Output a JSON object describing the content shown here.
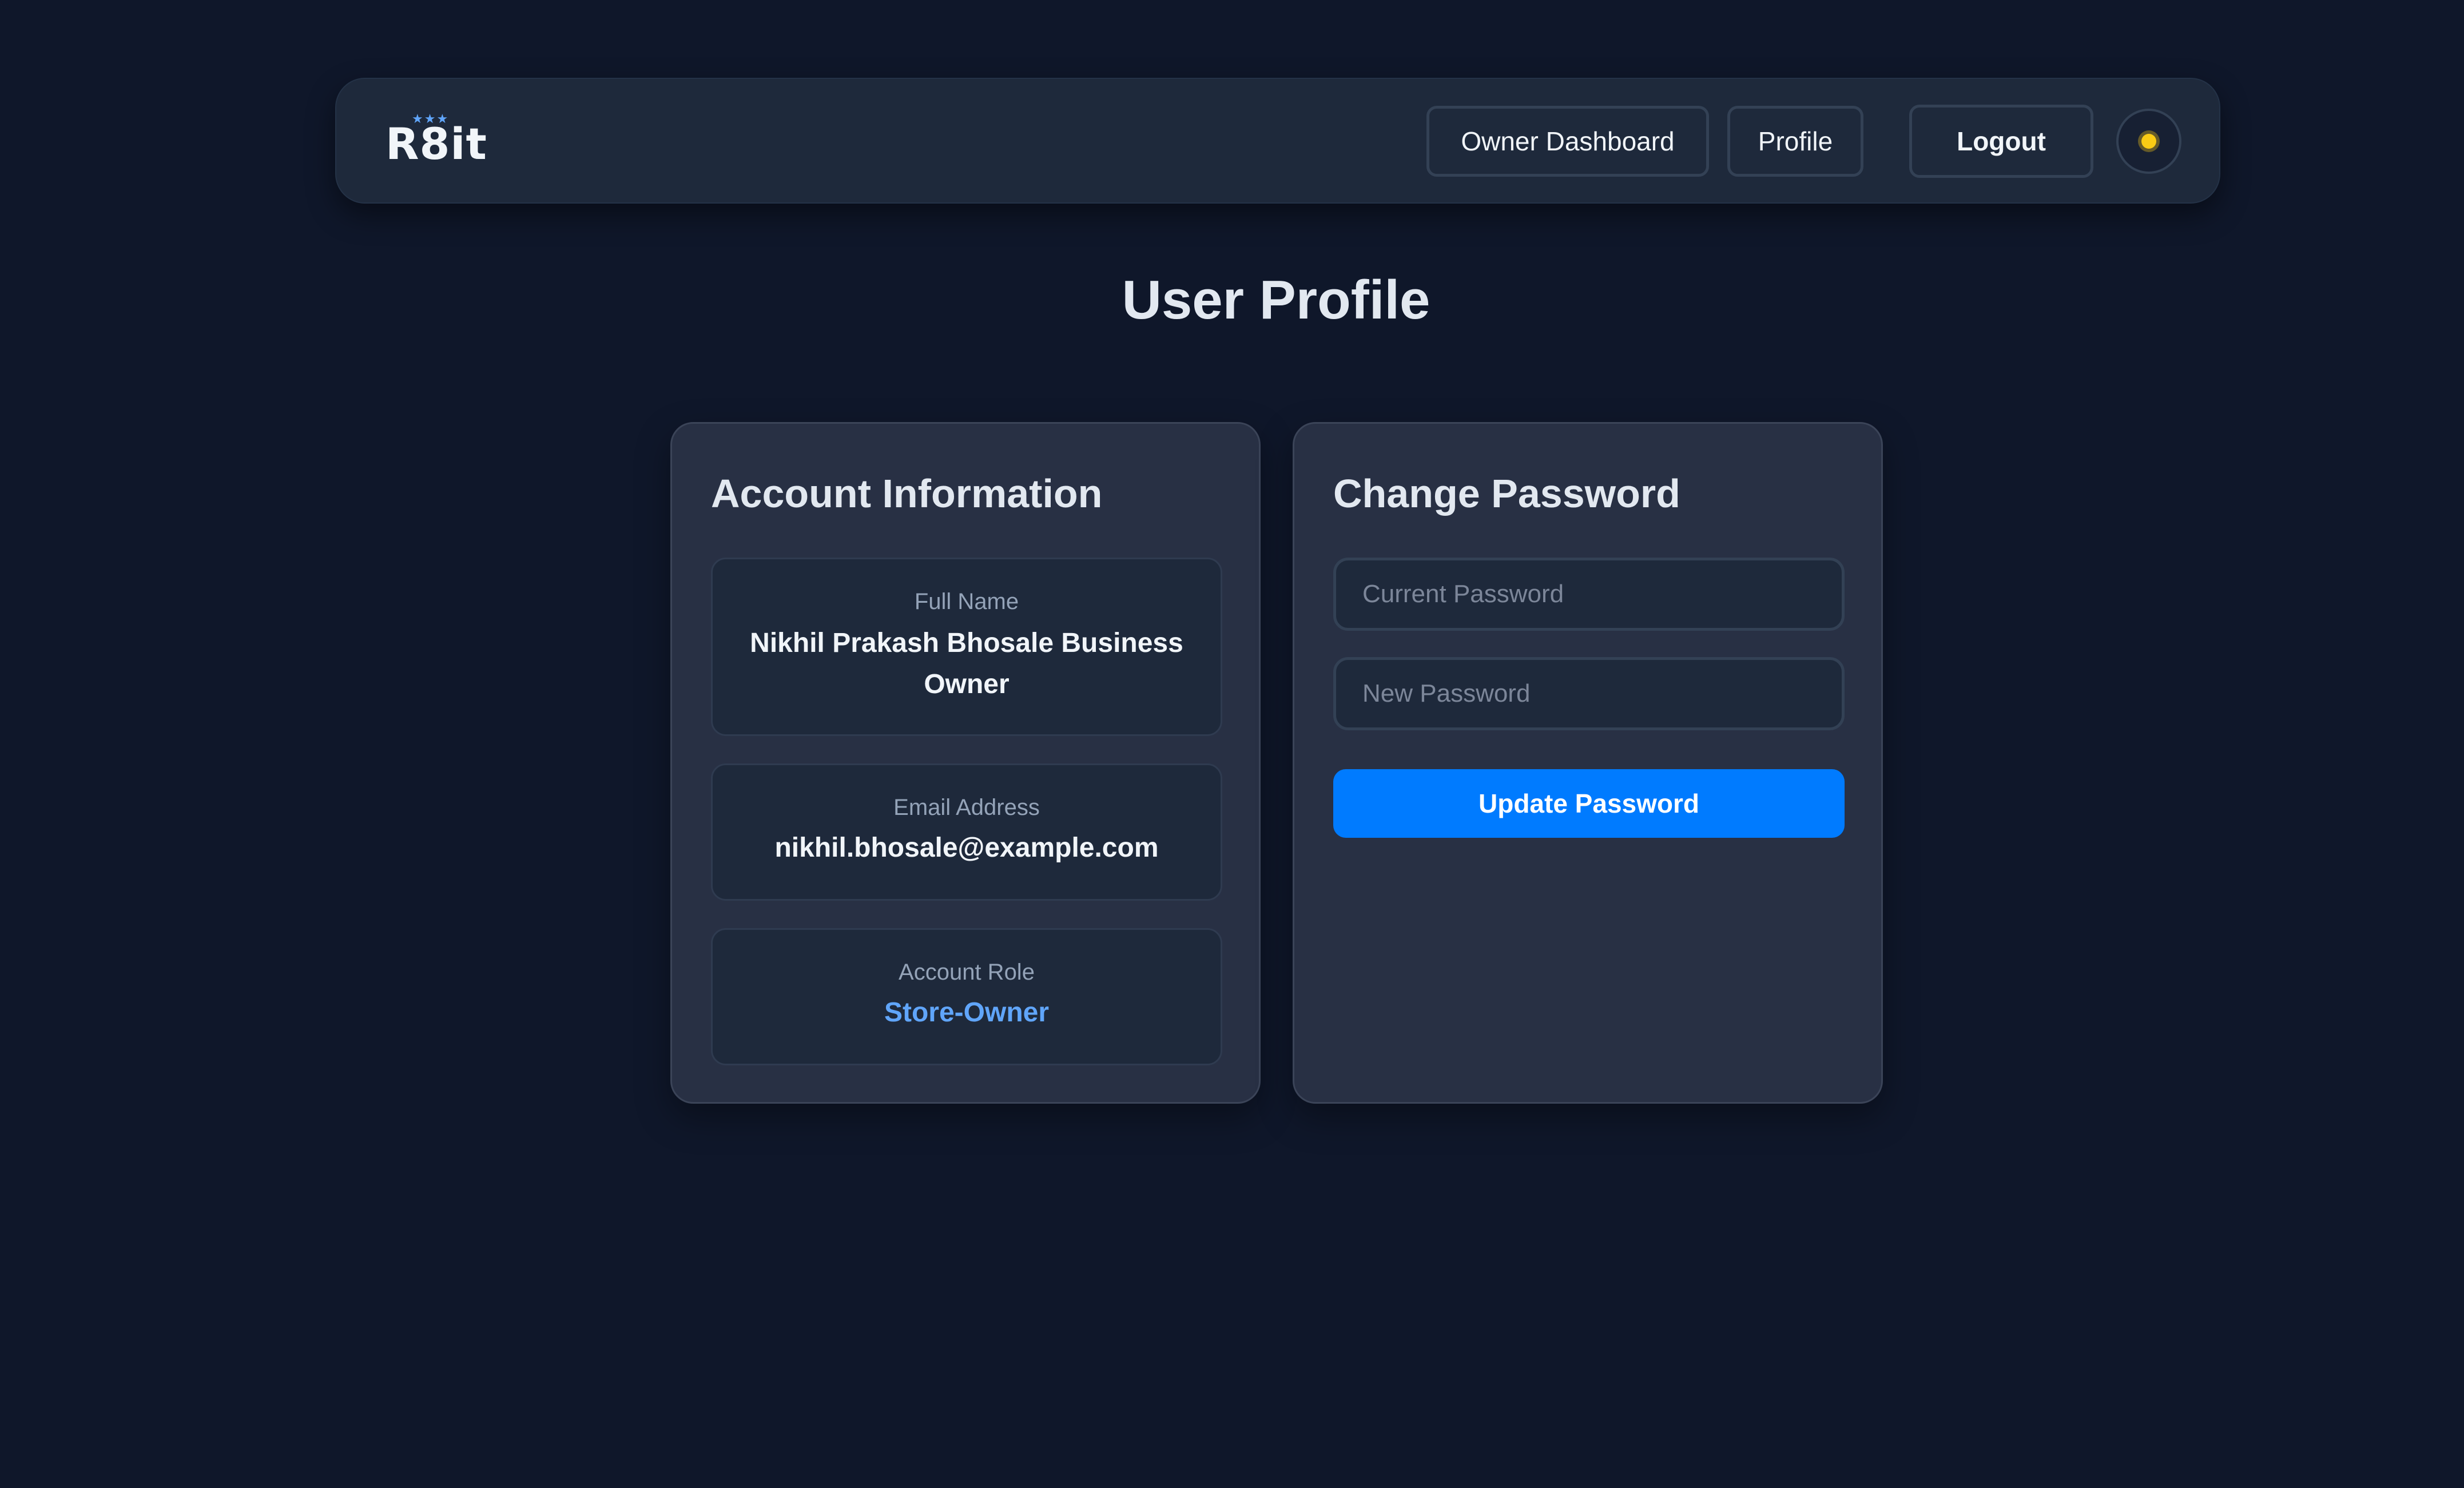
{
  "navbar": {
    "logo_text": "R8it",
    "logo_stars": "★★★",
    "links": {
      "owner_dashboard": "Owner Dashboard",
      "profile": "Profile"
    },
    "logout_label": "Logout",
    "theme_toggle_icon": "sun-icon"
  },
  "page": {
    "title": "User Profile"
  },
  "account_info": {
    "heading": "Account Information",
    "full_name_label": "Full Name",
    "full_name_value": "Nikhil Prakash Bhosale Business Owner",
    "email_label": "Email Address",
    "email_value": "nikhil.bhosale@example.com",
    "role_label": "Account Role",
    "role_value": "Store-Owner"
  },
  "change_password": {
    "heading": "Change Password",
    "current_password_placeholder": "Current Password",
    "current_password_value": "",
    "new_password_placeholder": "New Password",
    "new_password_value": "",
    "submit_label": "Update Password"
  },
  "colors": {
    "background": "#0f172a",
    "surface": "#1e293b",
    "card": "#283044",
    "accent": "#007bff",
    "role_text": "#60a5fa",
    "sun": "#facc15"
  }
}
